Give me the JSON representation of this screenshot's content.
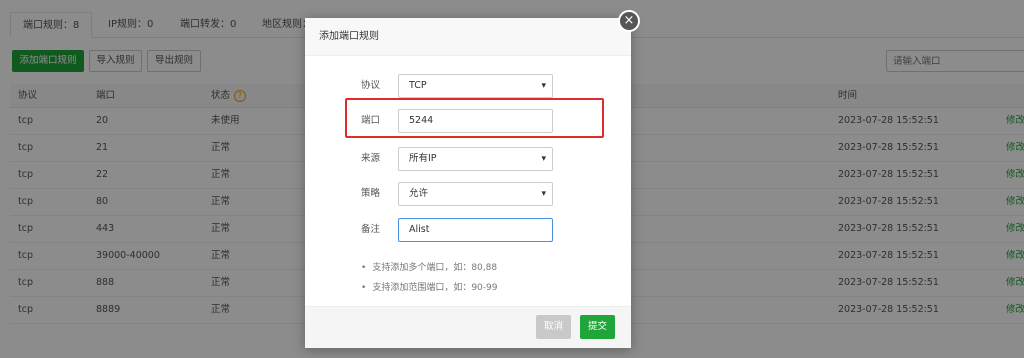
{
  "tabs": [
    "端口规则：8",
    "IP规则：0",
    "端口转发：0",
    "地区规则："
  ],
  "toolbar": {
    "add": "添加端口规则",
    "import": "导入规则",
    "export": "导出规则"
  },
  "search": {
    "placeholder": "请输入端口"
  },
  "table": {
    "headers": {
      "protocol": "协议",
      "port": "端口",
      "status": "状态",
      "time": "时间"
    },
    "status_help_icon": "question-icon",
    "rows": [
      {
        "protocol": "tcp",
        "port": "20",
        "status": "未使用",
        "time": "2023-07-28 15:52:51",
        "action": "修改"
      },
      {
        "protocol": "tcp",
        "port": "21",
        "status": "正常",
        "time": "2023-07-28 15:52:51",
        "action": "修改"
      },
      {
        "protocol": "tcp",
        "port": "22",
        "status": "正常",
        "time": "2023-07-28 15:52:51",
        "action": "修改"
      },
      {
        "protocol": "tcp",
        "port": "80",
        "status": "正常",
        "time": "2023-07-28 15:52:51",
        "action": "修改"
      },
      {
        "protocol": "tcp",
        "port": "443",
        "status": "正常",
        "time": "2023-07-28 15:52:51",
        "action": "修改"
      },
      {
        "protocol": "tcp",
        "port": "39000-40000",
        "status": "正常",
        "time": "2023-07-28 15:52:51",
        "action": "修改"
      },
      {
        "protocol": "tcp",
        "port": "888",
        "status": "正常",
        "time": "2023-07-28 15:52:51",
        "action": "修改"
      },
      {
        "protocol": "tcp",
        "port": "8889",
        "status": "正常",
        "time": "2023-07-28 15:52:51",
        "action": "修改"
      }
    ]
  },
  "modal": {
    "title": "添加端口规则",
    "close_icon": "close-icon",
    "fields": {
      "protocol": {
        "label": "协议",
        "value": "TCP"
      },
      "port": {
        "label": "端口",
        "value": "5244"
      },
      "source": {
        "label": "来源",
        "value": "所有IP"
      },
      "strategy": {
        "label": "策略",
        "value": "允许"
      },
      "remark": {
        "label": "备注",
        "value": "Alist"
      }
    },
    "tips": [
      "支持添加多个端口，如：80,88",
      "支持添加范围端口，如：90-99"
    ],
    "cancel": "取消",
    "submit": "提交"
  },
  "colors": {
    "brand_green": "#20a53a",
    "highlight_red": "#e12b2b"
  }
}
